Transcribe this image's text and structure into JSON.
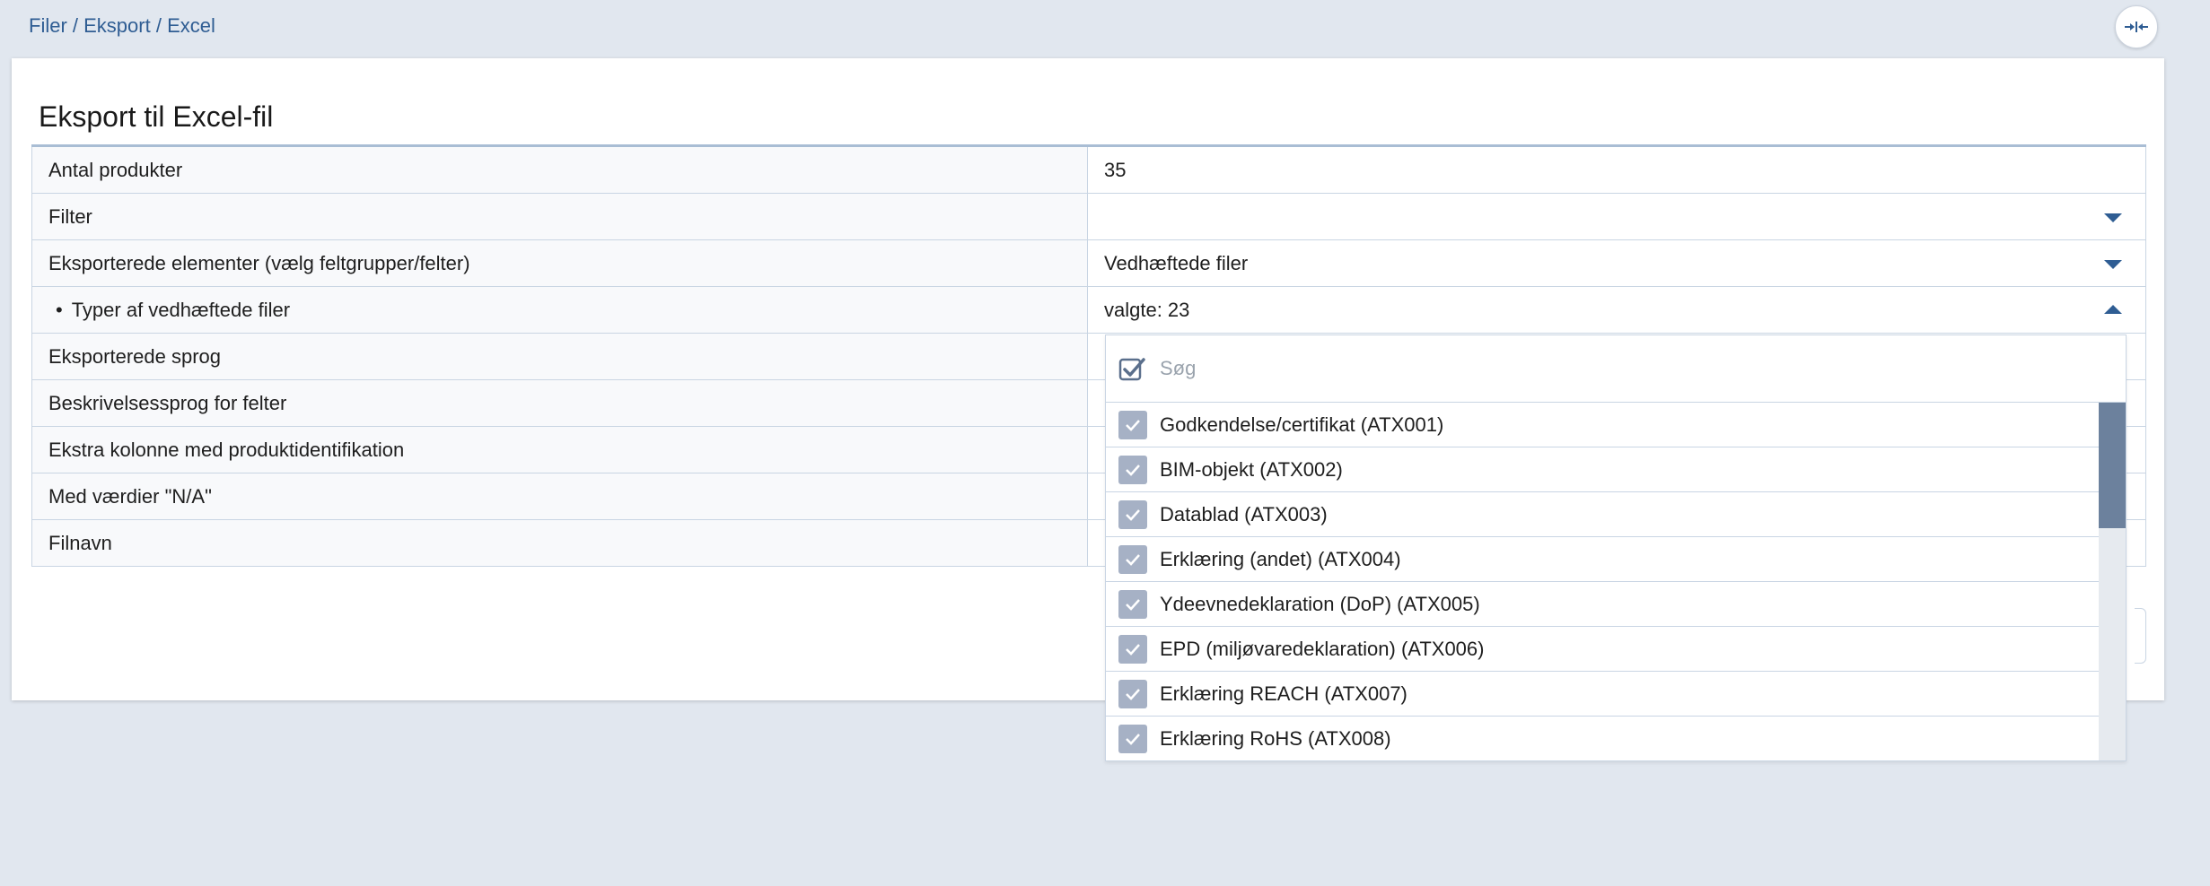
{
  "breadcrumb": {
    "items": [
      "Filer",
      "Eksport",
      "Excel"
    ],
    "separator": " / "
  },
  "panel": {
    "title": "Eksport til Excel-fil"
  },
  "form": {
    "rows": [
      {
        "label": "Antal produkter",
        "value": "35"
      },
      {
        "label": "Filter",
        "value": ""
      },
      {
        "label": "Eksporterede elementer (vælg feltgrupper/felter)",
        "value": "Vedhæftede filer"
      },
      {
        "label": "Typer af vedhæftede filer",
        "bullet": "•",
        "value": "valgte: 23"
      },
      {
        "label": "Eksporterede sprog",
        "value": ""
      },
      {
        "label": "Beskrivelsessprog for felter",
        "value": ""
      },
      {
        "label": "Ekstra kolonne med produktidentifikation",
        "value": ""
      },
      {
        "label": "Med værdier \"N/A\"",
        "value": ""
      },
      {
        "label": "Filnavn",
        "value": ""
      }
    ]
  },
  "dropdown": {
    "search_placeholder": "Søg",
    "options": [
      {
        "label": "Godkendelse/certifikat (ATX001)",
        "checked": true
      },
      {
        "label": "BIM-objekt (ATX002)",
        "checked": true
      },
      {
        "label": "Datablad (ATX003)",
        "checked": true
      },
      {
        "label": "Erklæring (andet) (ATX004)",
        "checked": true
      },
      {
        "label": "Ydeevnedeklaration (DoP) (ATX005)",
        "checked": true
      },
      {
        "label": "EPD (miljøvaredeklaration) (ATX006)",
        "checked": true
      },
      {
        "label": "Erklæring REACH (ATX007)",
        "checked": true
      },
      {
        "label": "Erklæring RoHS (ATX008)",
        "checked": true
      }
    ],
    "scroll_position": 0
  },
  "colors": {
    "accent": "#2f5d93",
    "checkbox": "#a6b1c5",
    "background": "#e1e7ef",
    "scroll_thumb": "#6c819d"
  }
}
